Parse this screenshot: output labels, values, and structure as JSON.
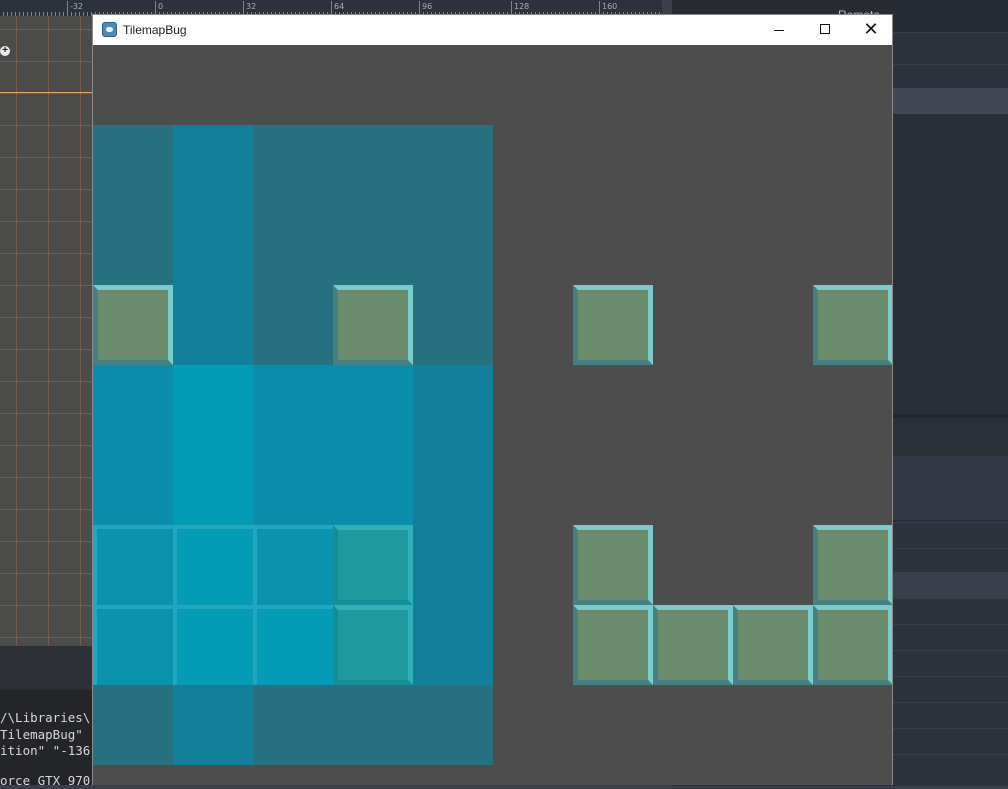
{
  "editor": {
    "ruler_labels": [
      "-32",
      "0",
      "32",
      "64",
      "96",
      "128",
      "160"
    ],
    "dock_tab_label": "Remote",
    "output_lines": [
      "/\\Libraries\\",
      "TilemapBug\"",
      "ition\" \"-136",
      "",
      "orce GTX 970"
    ]
  },
  "game_window": {
    "title": "TilemapBug",
    "icon": "godot-icon",
    "controls": {
      "minimize": "minimize-icon",
      "maximize": "maximize-icon",
      "close": "close-icon",
      "close_glyph": "✕"
    }
  },
  "tilemap": {
    "tile_size_label": "",
    "colors": {
      "background": "#4d4d4d",
      "ground": "#6a8b6c",
      "ground_highlight": "#78cccc",
      "water_dark": "#26707f",
      "water_bright": "#049bb6"
    },
    "grid": [
      [
        "water-dark",
        "water-mid",
        "water-dark",
        "water-dark",
        "water-dark",
        "empty",
        "empty",
        "empty",
        "empty",
        "empty"
      ],
      [
        "water-dark",
        "water-mid",
        "water-dark",
        "water-dark",
        "water-dark",
        "empty",
        "empty",
        "empty",
        "empty",
        "empty"
      ],
      [
        "ground",
        "water-mid",
        "water-dark",
        "ground",
        "water-dark",
        "empty",
        "ground",
        "empty",
        "empty",
        "ground"
      ],
      [
        "water-light",
        "water-bright",
        "water-light",
        "water-light",
        "water-mid",
        "empty",
        "empty",
        "empty",
        "empty",
        "empty"
      ],
      [
        "water-light",
        "water-bright",
        "water-light",
        "water-light",
        "water-mid",
        "empty",
        "empty",
        "empty",
        "empty",
        "empty"
      ],
      [
        "water-tile",
        "water-tile-bright",
        "water-tile",
        "ground-submerged",
        "water-mid",
        "empty",
        "ground",
        "empty",
        "empty",
        "ground"
      ],
      [
        "water-tile",
        "water-tile-bright",
        "water-tile-bright",
        "ground-submerged",
        "water-mid",
        "empty",
        "ground",
        "ground",
        "ground",
        "ground"
      ],
      [
        "water-dark",
        "water-mid",
        "water-dark",
        "water-dark",
        "water-dark",
        "empty",
        "empty",
        "empty",
        "empty",
        "empty"
      ]
    ]
  }
}
